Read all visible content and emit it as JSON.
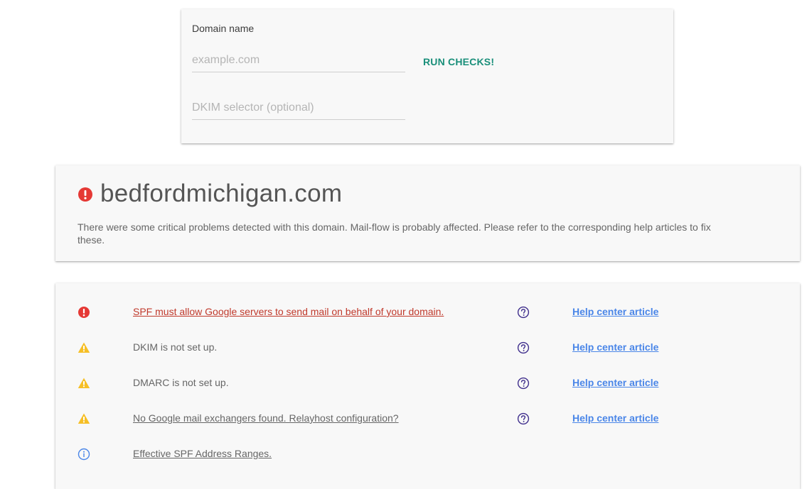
{
  "form": {
    "domain_label": "Domain name",
    "domain_value": "",
    "domain_placeholder": "example.com",
    "dkim_value": "",
    "dkim_placeholder": "DKIM selector (optional)",
    "run_button_label": "RUN CHECKS!"
  },
  "summary": {
    "status": "critical",
    "domain": "bedfordmichigan.com",
    "message": "There were some critical problems detected with this domain. Mail-flow is probably affected. Please refer to the corresponding help articles to fix these."
  },
  "results": [
    {
      "status": "critical",
      "status_icon": "error-icon",
      "message": "SPF must allow Google servers to send mail on behalf of your domain.",
      "message_is_link": true,
      "has_help": true,
      "help_label": "Help center article"
    },
    {
      "status": "warning",
      "status_icon": "warning-icon",
      "message": "DKIM is not set up.",
      "message_is_link": false,
      "has_help": true,
      "help_label": "Help center article"
    },
    {
      "status": "warning",
      "status_icon": "warning-icon",
      "message": "DMARC is not set up.",
      "message_is_link": false,
      "has_help": true,
      "help_label": "Help center article"
    },
    {
      "status": "warning",
      "status_icon": "warning-icon",
      "message": "No Google mail exchangers found. Relayhost configuration?",
      "message_is_link": true,
      "has_help": true,
      "help_label": "Help center article"
    },
    {
      "status": "info",
      "status_icon": "info-icon",
      "message": "Effective SPF Address Ranges.",
      "message_is_link": true,
      "has_help": false
    }
  ],
  "colors": {
    "critical": "#e53935",
    "warning": "#f6bf26",
    "info": "#4a86e8",
    "help_icon": "#3f2e8c",
    "accent": "#1a8f7a",
    "link": "#4a86e8"
  }
}
